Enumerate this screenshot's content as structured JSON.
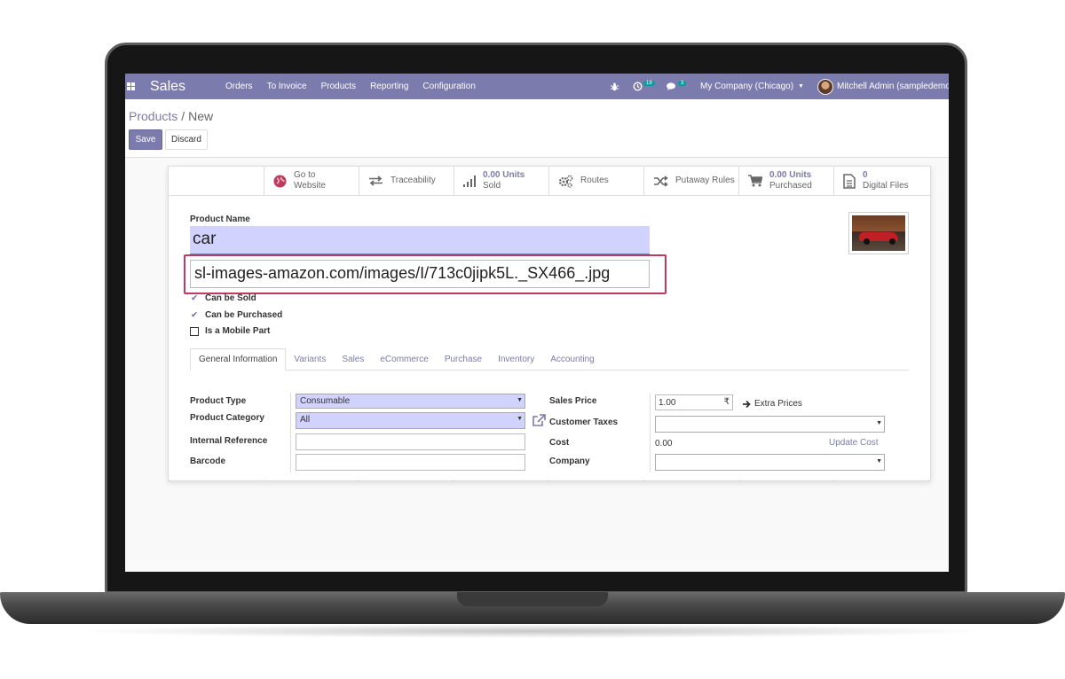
{
  "navbar": {
    "brand": "Sales",
    "menu": [
      "Orders",
      "To Invoice",
      "Products",
      "Reporting",
      "Configuration"
    ],
    "activity_count": "19",
    "message_count": "3",
    "company": "My Company (Chicago)",
    "user": "Mitchell Admin (sampledemo"
  },
  "breadcrumb": {
    "parent": "Products",
    "separator": "/",
    "current": "New"
  },
  "buttons": {
    "save": "Save",
    "discard": "Discard"
  },
  "smart_buttons": [
    {
      "line1": "Go to",
      "line2": "Website",
      "icon": "globe-icon"
    },
    {
      "line1": "Traceability",
      "line2": "",
      "icon": "exchange-icon"
    },
    {
      "line1": "0.00 Units",
      "line2": "Sold",
      "icon": "bar-chart-icon"
    },
    {
      "line1": "Routes",
      "line2": "",
      "icon": "cogs-icon"
    },
    {
      "line1": "Putaway Rules",
      "line2": "",
      "icon": "random-icon"
    },
    {
      "line1": "0.00 Units",
      "line2": "Purchased",
      "icon": "cart-icon"
    },
    {
      "line1": "0",
      "line2": "Digital Files",
      "icon": "file-icon"
    }
  ],
  "form": {
    "product_name_label": "Product Name",
    "product_name": "car",
    "image_url": "sl-images-amazon.com/images/I/713c0jipk5L._SX466_.jpg",
    "can_be_sold": "Can be Sold",
    "can_be_purchased": "Can be Purchased",
    "is_mobile_part": "Is a Mobile Part"
  },
  "tabs": [
    "General Information",
    "Variants",
    "Sales",
    "eCommerce",
    "Purchase",
    "Inventory",
    "Accounting"
  ],
  "general": {
    "product_type_label": "Product Type",
    "product_type": "Consumable",
    "product_category_label": "Product Category",
    "product_category": "All",
    "internal_reference_label": "Internal Reference",
    "barcode_label": "Barcode",
    "sales_price_label": "Sales Price",
    "sales_price": "1.00",
    "currency_symbol": "₹",
    "extra_prices": "Extra Prices",
    "customer_taxes_label": "Customer Taxes",
    "cost_label": "Cost",
    "cost": "0.00",
    "update_cost": "Update Cost",
    "company_label": "Company"
  },
  "colors": {
    "brand": "#7c7bad",
    "highlight": "#c0395f",
    "required_field": "#d2d2ff"
  }
}
